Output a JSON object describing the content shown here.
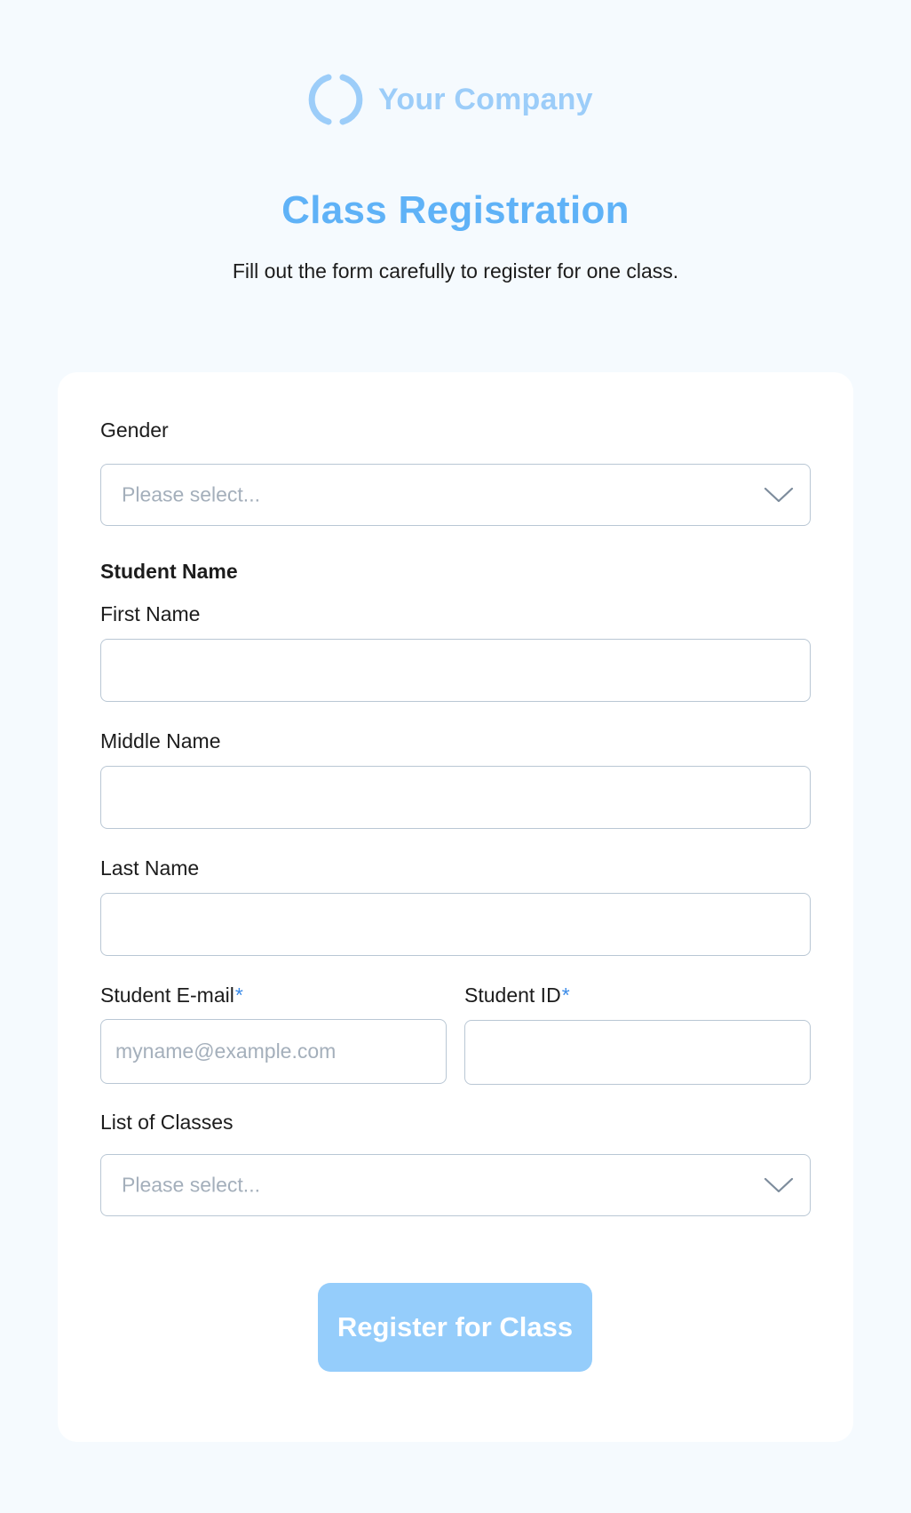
{
  "brand": {
    "name": "Your Company",
    "icon": "logo-ring-icon",
    "color": "#9ccdf9"
  },
  "header": {
    "title": "Class Registration",
    "subtitle": "Fill out the form carefully to register for one class.",
    "title_color": "#5fb2f7"
  },
  "form": {
    "gender": {
      "label": "Gender",
      "placeholder": "Please select..."
    },
    "student_name_section": "Student Name",
    "first_name": {
      "label": "First Name",
      "value": ""
    },
    "middle_name": {
      "label": "Middle Name",
      "value": ""
    },
    "last_name": {
      "label": "Last Name",
      "value": ""
    },
    "email": {
      "label": "Student E-mail",
      "required_marker": "*",
      "placeholder": "myname@example.com",
      "value": ""
    },
    "student_id": {
      "label": "Student ID",
      "required_marker": "*",
      "value": ""
    },
    "classes": {
      "label": "List of Classes",
      "placeholder": "Please select..."
    },
    "submit_label": "Register for Class",
    "submit_color": "#95cdfb"
  }
}
